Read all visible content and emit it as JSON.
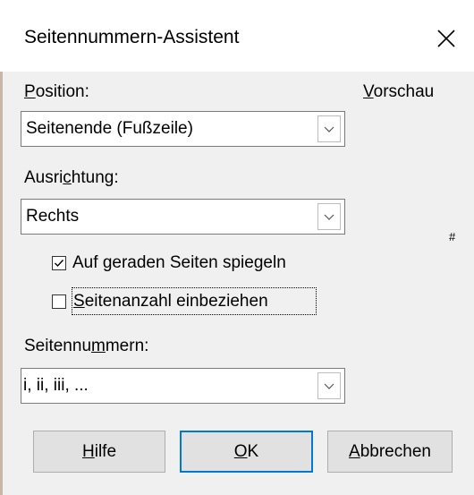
{
  "dialog": {
    "title": "Seitennummern-Assistent",
    "close_icon": "close-icon"
  },
  "position": {
    "label_first": "P",
    "label_rest": "osition:",
    "value": "Seitenende (Fußzeile)"
  },
  "preview": {
    "label_first": "V",
    "label_rest": "orschau",
    "marker": "#"
  },
  "alignment": {
    "label_before": "Ausri",
    "label_ul": "c",
    "label_after": "htung:",
    "value": "Rechts"
  },
  "mirror": {
    "checked": true,
    "label_before": "Auf ",
    "label_ul": "g",
    "label_after": "eraden Seiten spiegeln"
  },
  "page_count": {
    "checked": false,
    "label_ul": "S",
    "label_after": "eitenanzahl einbeziehen"
  },
  "numbering": {
    "label_before": "Seitennu",
    "label_ul": "m",
    "label_after": "mern:",
    "value": "i, ii, iii, ..."
  },
  "buttons": {
    "help_ul": "H",
    "help_rest": "ilfe",
    "ok_ul": "O",
    "ok_rest": "K",
    "cancel_ul": "A",
    "cancel_rest": "bbrechen"
  },
  "colors": {
    "focus_border": "#0078d7",
    "dialog_bg": "#f0f0f0"
  }
}
